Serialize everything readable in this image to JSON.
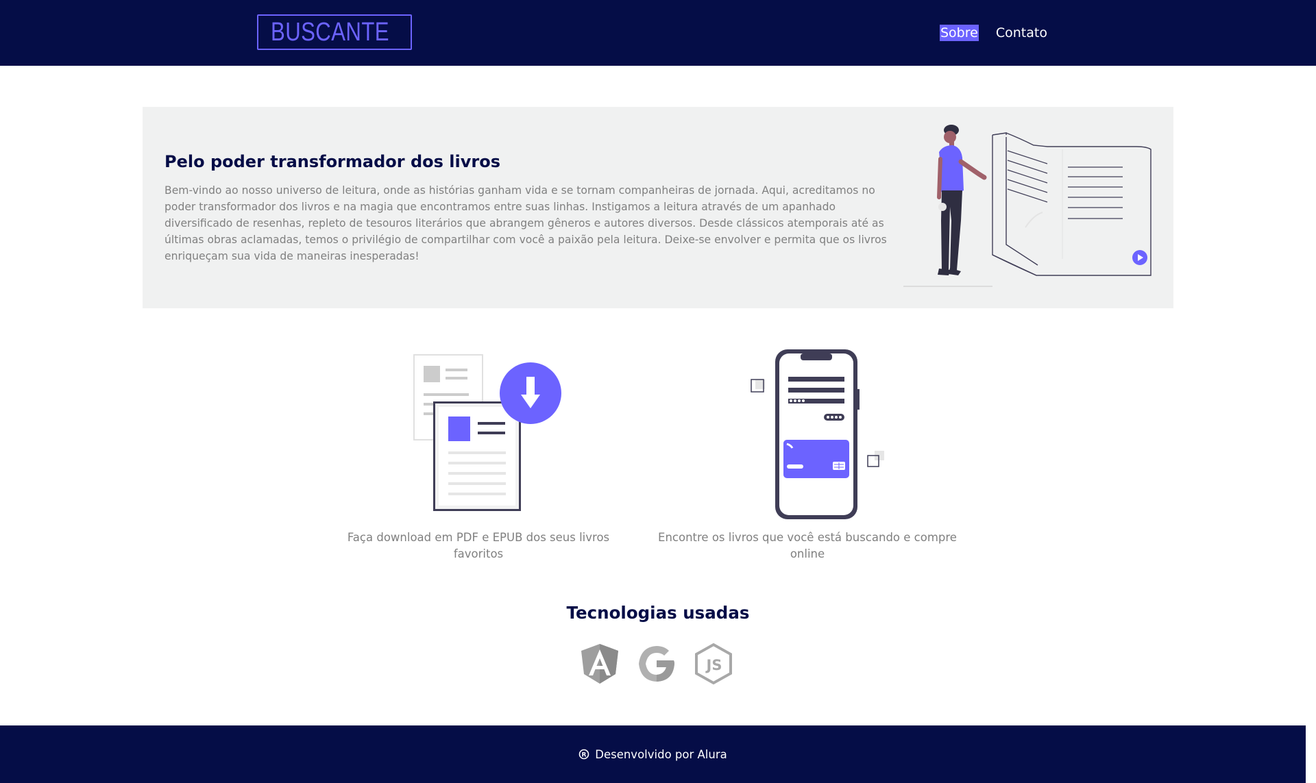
{
  "header": {
    "logo_text": "BUSCANTE",
    "nav": [
      {
        "label": "Sobre",
        "active": true
      },
      {
        "label": "Contato",
        "active": false
      }
    ]
  },
  "hero": {
    "title": "Pelo poder transformador dos livros",
    "text": "Bem-vindo ao nosso universo de leitura, onde as histórias ganham vida e se tornam companheiras de jornada. Aqui, acreditamos no poder transformador dos livros e na magia que encontramos entre suas linhas. Instigamos a leitura através de um apanhado diversificado de resenhas, repleto de tesouros literários que abrangem gêneros e autores diversos. Desde clássicos atemporais até as últimas obras aclamadas, temos o privilégio de compartilhar com você a paixão pela leitura. Deixe-se envolver e permita que os livros enriqueçam sua vida de maneiras inesperadas!"
  },
  "features": [
    {
      "caption": "Faça download em PDF e EPUB dos seus livros favoritos"
    },
    {
      "caption": "Encontre os livros que você está buscando e compre online"
    }
  ],
  "tech": {
    "title": "Tecnologias usadas",
    "icons": [
      "angular-icon",
      "google-icon",
      "nodejs-icon"
    ]
  },
  "footer": {
    "icon": "registered-icon",
    "text": "Desenvolvido por Alura"
  },
  "colors": {
    "navy": "#050d47",
    "accent": "#6c63ff",
    "hero_bg": "#f0f1f1",
    "muted_text": "#808080"
  }
}
